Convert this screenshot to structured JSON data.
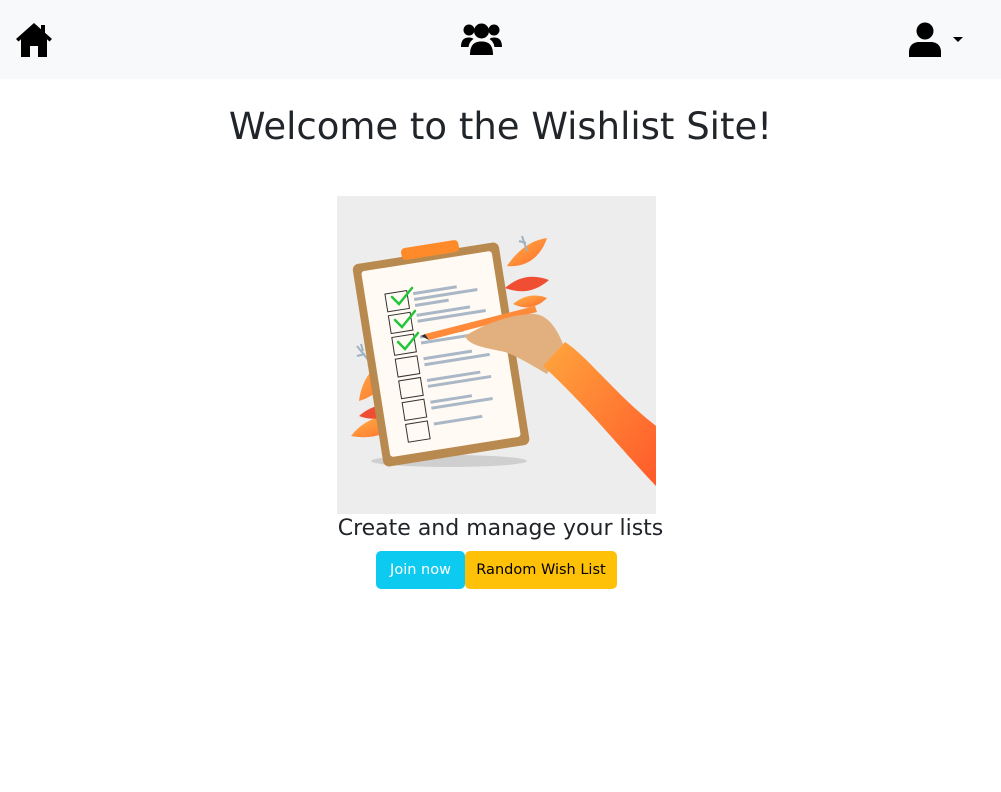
{
  "navbar": {
    "home_icon": "home-icon",
    "users_icon": "users-icon",
    "account_icon": "user-icon",
    "account_menu_icon": "caret-down-icon"
  },
  "main": {
    "title": "Welcome to the Wishlist Site!",
    "hero_image": "clipboard-checklist-illustration",
    "tagline": "Create and manage your lists",
    "join_button_label": "Join now",
    "random_button_label": "Random Wish List"
  },
  "colors": {
    "navbar_bg": "#f8f9fa",
    "join_button": "#0dcaf0",
    "random_button": "#ffc107",
    "text": "#212529"
  }
}
